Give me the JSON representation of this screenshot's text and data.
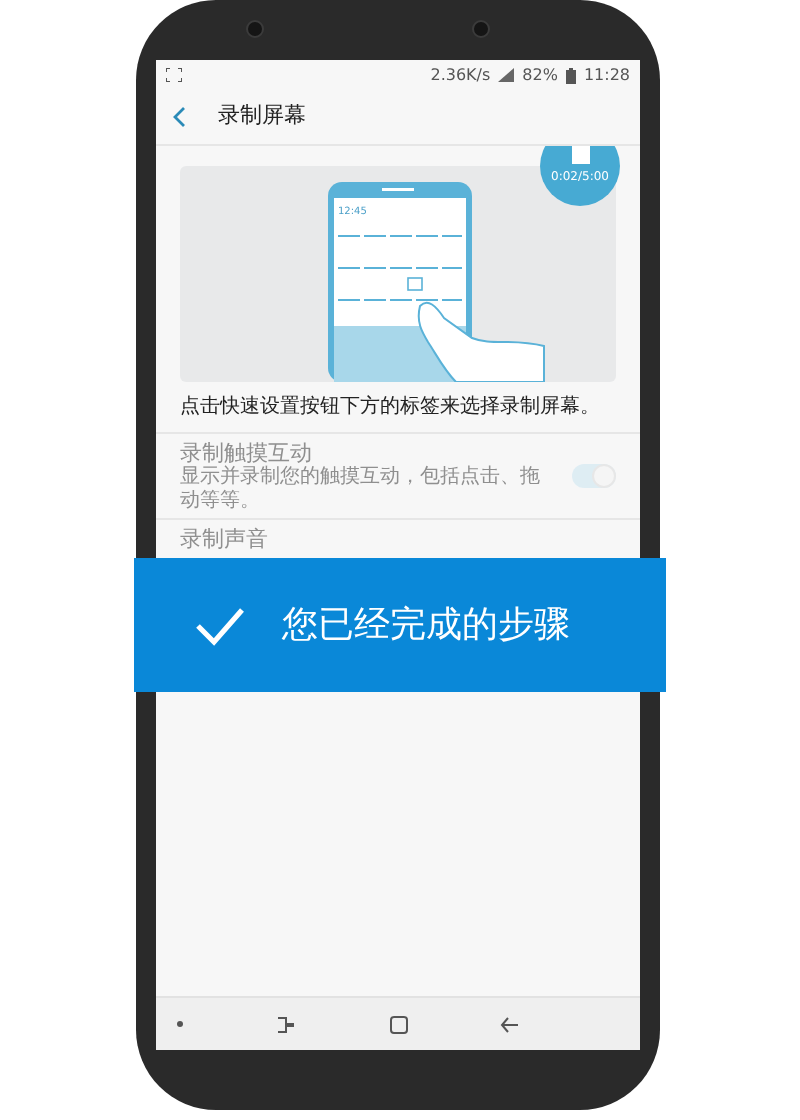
{
  "status_bar": {
    "speed": "2.36K/s",
    "battery": "82%",
    "time": "11:28"
  },
  "header": {
    "title": "录制屏幕"
  },
  "illustration": {
    "clock": "12:45",
    "timer": "0:02/5:00"
  },
  "caption": "点击快速设置按钮下方的标签来选择录制屏幕。",
  "settings": [
    {
      "kind": "toggle",
      "title": "录制触摸互动",
      "subtitle": "显示并录制您的触摸互动，包括点击、拖动等等。",
      "on": true,
      "disabled": true
    },
    {
      "kind": "plain",
      "title": "录制声音",
      "disabled": true
    }
  ],
  "banner": {
    "text": "您已经完成的步骤"
  }
}
